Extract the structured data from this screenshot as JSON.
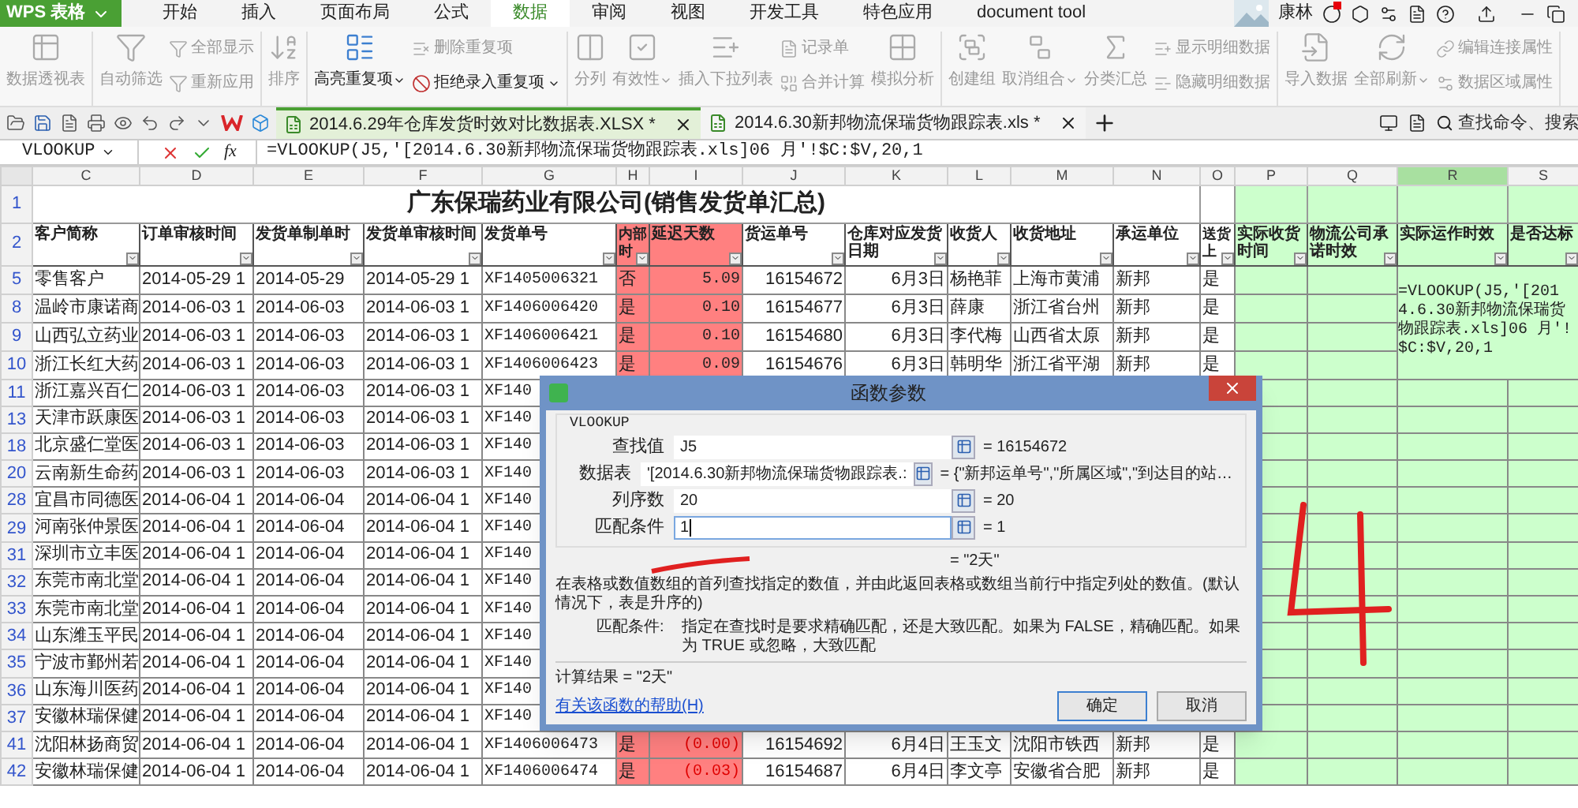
{
  "app_button": {
    "label": "WPS 表格"
  },
  "menu_tabs": [
    {
      "label": "开始",
      "selected": false
    },
    {
      "label": "插入",
      "selected": false
    },
    {
      "label": "页面布局",
      "selected": false
    },
    {
      "label": "公式",
      "selected": false
    },
    {
      "label": "数据",
      "selected": true
    },
    {
      "label": "审阅",
      "selected": false
    },
    {
      "label": "视图",
      "selected": false
    },
    {
      "label": "开发工具",
      "selected": false
    },
    {
      "label": "特色应用",
      "selected": false
    },
    {
      "label": "document tool",
      "selected": false
    }
  ],
  "user": {
    "name": "康林"
  },
  "ribbon": {
    "groups": [
      {
        "columns": [
          {
            "kind": "large",
            "items": [
              {
                "label": "数据透视表",
                "disabled": true,
                "dropdown": false
              }
            ]
          }
        ]
      },
      {
        "columns": [
          {
            "kind": "large",
            "items": [
              {
                "label": "自动筛选",
                "disabled": true,
                "dropdown": false
              }
            ]
          },
          {
            "kind": "small",
            "items": [
              {
                "label": "全部显示",
                "disabled": true,
                "dropdown": false
              },
              {
                "label": "重新应用",
                "disabled": true,
                "dropdown": false
              }
            ]
          }
        ]
      },
      {
        "columns": [
          {
            "kind": "large",
            "items": [
              {
                "label": "排序",
                "disabled": true,
                "dropdown": false
              }
            ]
          }
        ]
      },
      {
        "columns": [
          {
            "kind": "large",
            "items": [
              {
                "label": "高亮重复项",
                "disabled": false,
                "dropdown": true
              }
            ]
          },
          {
            "kind": "small",
            "items": [
              {
                "label": "删除重复项",
                "disabled": true,
                "dropdown": false
              },
              {
                "label": "拒绝录入重复项",
                "disabled": false,
                "dropdown": true
              }
            ]
          }
        ]
      },
      {
        "columns": [
          {
            "kind": "large",
            "items": [
              {
                "label": "分列",
                "disabled": true,
                "dropdown": false
              }
            ]
          },
          {
            "kind": "large",
            "items": [
              {
                "label": "有效性",
                "disabled": true,
                "dropdown": true
              }
            ]
          },
          {
            "kind": "large",
            "items": [
              {
                "label": "插入下拉列表",
                "disabled": true,
                "dropdown": false
              }
            ]
          },
          {
            "kind": "small",
            "items": [
              {
                "label": "记录单",
                "disabled": true,
                "dropdown": false
              },
              {
                "label": "合并计算",
                "disabled": true,
                "dropdown": false
              }
            ]
          },
          {
            "kind": "large",
            "items": [
              {
                "label": "模拟分析",
                "disabled": true,
                "dropdown": false
              }
            ]
          }
        ]
      },
      {
        "columns": [
          {
            "kind": "large",
            "items": [
              {
                "label": "创建组",
                "disabled": true,
                "dropdown": false
              }
            ]
          },
          {
            "kind": "large",
            "items": [
              {
                "label": "取消组合",
                "disabled": true,
                "dropdown": true
              }
            ]
          },
          {
            "kind": "large",
            "items": [
              {
                "label": "分类汇总",
                "disabled": true,
                "dropdown": false
              }
            ]
          },
          {
            "kind": "small",
            "items": [
              {
                "label": "显示明细数据",
                "disabled": true,
                "dropdown": false
              },
              {
                "label": "隐藏明细数据",
                "disabled": true,
                "dropdown": false
              }
            ]
          }
        ]
      },
      {
        "columns": [
          {
            "kind": "large",
            "items": [
              {
                "label": "导入数据",
                "disabled": true,
                "dropdown": false
              }
            ]
          },
          {
            "kind": "large",
            "items": [
              {
                "label": "全部刷新",
                "disabled": true,
                "dropdown": true
              }
            ]
          },
          {
            "kind": "small",
            "items": [
              {
                "label": "编辑连接属性",
                "disabled": true,
                "dropdown": false
              },
              {
                "label": "数据区域属性",
                "disabled": true,
                "dropdown": false
              }
            ]
          }
        ]
      }
    ]
  },
  "file_tabs": [
    {
      "label": "2014.6.29年仓库发货时效对比数据表.XLSX *",
      "selected": true
    },
    {
      "label": "2014.6.30新邦物流保瑞货物跟踪表.xls *",
      "selected": false
    }
  ],
  "command_search": {
    "placeholder": "查找命令、搜索"
  },
  "formula_bar": {
    "name_box": "VLOOKUP",
    "fx_label": "fx",
    "formula": "=VLOOKUP(J5,'[2014.6.30新邦物流保瑞货物跟踪表.xls]06 月'!$C:$V,20,1"
  },
  "sheet": {
    "title_row_num": "1",
    "header_row_num": "2",
    "title": "广东保瑞药业有限公司(销售发货单汇总)",
    "columns": [
      {
        "letter": "C",
        "header": "客户简称",
        "selected": false
      },
      {
        "letter": "D",
        "header": "订单审核时间",
        "selected": false
      },
      {
        "letter": "E",
        "header": "发货单制单时",
        "selected": false
      },
      {
        "letter": "F",
        "header": "发货单审核时间",
        "selected": false
      },
      {
        "letter": "G",
        "header": "发货单号",
        "selected": false
      },
      {
        "letter": "H",
        "header": "内部时",
        "color": "#ff8080",
        "selected": false
      },
      {
        "letter": "I",
        "header": "延迟天数",
        "color": "#ff8080",
        "selected": false
      },
      {
        "letter": "J",
        "header": "货运单号",
        "selected": false
      },
      {
        "letter": "K",
        "header": "仓库对应发货日期",
        "selected": false
      },
      {
        "letter": "L",
        "header": "收货人",
        "selected": false
      },
      {
        "letter": "M",
        "header": "收货地址",
        "selected": false
      },
      {
        "letter": "N",
        "header": "承运单位",
        "selected": false
      },
      {
        "letter": "O",
        "header": "送货上",
        "selected": false
      },
      {
        "letter": "P",
        "header": "实际收货时间",
        "color": "#ccffcc",
        "selected": false
      },
      {
        "letter": "Q",
        "header": "物流公司承诺时效",
        "color": "#ccffcc",
        "selected": false
      },
      {
        "letter": "R",
        "header": "实际运作时效",
        "color": "#ccffcc",
        "selected": true
      },
      {
        "letter": "S",
        "header": "是否达标",
        "color": "#ccffcc",
        "selected": false
      }
    ],
    "rows": [
      {
        "num": "5",
        "negative": false,
        "cells": [
          "零售客户",
          "2014-05-29 1",
          "2014-05-29",
          "2014-05-29 1",
          "XF1405006321",
          "否",
          "5.09",
          "16154672",
          "6月3日",
          "杨艳菲",
          "上海市黄浦",
          "新邦",
          "是"
        ],
        "formula_cell": "=VLOOKUP(J5,'[2014.6.30新邦物流保瑞货物跟踪表.xls]06 月'!$C:$V,20,1"
      },
      {
        "num": "8",
        "negative": false,
        "cells": [
          "温岭市康诺商",
          "2014-06-03 1",
          "2014-06-03",
          "2014-06-03 1",
          "XF1406006420",
          "是",
          "0.10",
          "16154677",
          "6月3日",
          "薛康",
          "浙江省台州",
          "新邦",
          "是"
        ]
      },
      {
        "num": "9",
        "negative": false,
        "cells": [
          "山西弘立药业",
          "2014-06-03 1",
          "2014-06-03",
          "2014-06-03 1",
          "XF1406006421",
          "是",
          "0.10",
          "16154680",
          "6月3日",
          "李代梅",
          "山西省太原",
          "新邦",
          "是"
        ]
      },
      {
        "num": "10",
        "negative": false,
        "cells": [
          "浙江长红大药",
          "2014-06-03 1",
          "2014-06-03",
          "2014-06-03 1",
          "XF1406006423",
          "是",
          "0.09",
          "16154676",
          "6月3日",
          "韩明华",
          "浙江省平湖",
          "新邦",
          "是"
        ]
      },
      {
        "num": "11",
        "cells": [
          "浙江嘉兴百仁",
          "2014-06-03 1",
          "2014-06-03",
          "2014-06-03 1",
          "XF140"
        ]
      },
      {
        "num": "13",
        "cells": [
          "天津市跃康医",
          "2014-06-03 1",
          "2014-06-03",
          "2014-06-03 1",
          "XF140"
        ]
      },
      {
        "num": "18",
        "cells": [
          "北京盛仁堂医",
          "2014-06-03 1",
          "2014-06-03",
          "2014-06-03 1",
          "XF140"
        ]
      },
      {
        "num": "20",
        "cells": [
          "云南新生命药",
          "2014-06-03 1",
          "2014-06-03",
          "2014-06-03 1",
          "XF140"
        ]
      },
      {
        "num": "28",
        "cells": [
          "宜昌市同德医",
          "2014-06-04 1",
          "2014-06-04",
          "2014-06-04 1",
          "XF140"
        ]
      },
      {
        "num": "29",
        "cells": [
          "河南张仲景医",
          "2014-06-04 1",
          "2014-06-04",
          "2014-06-04 1",
          "XF140"
        ]
      },
      {
        "num": "31",
        "cells": [
          "深圳市立丰医",
          "2014-06-04 1",
          "2014-06-04",
          "2014-06-04 1",
          "XF140"
        ]
      },
      {
        "num": "32",
        "cells": [
          "东莞市南北堂",
          "2014-06-04 1",
          "2014-06-04",
          "2014-06-04 1",
          "XF140"
        ]
      },
      {
        "num": "33",
        "cells": [
          "东莞市南北堂",
          "2014-06-04 1",
          "2014-06-04",
          "2014-06-04 1",
          "XF140"
        ]
      },
      {
        "num": "34",
        "cells": [
          "山东潍玉平民",
          "2014-06-04 1",
          "2014-06-04",
          "2014-06-04 1",
          "XF140"
        ]
      },
      {
        "num": "35",
        "cells": [
          "宁波市鄞州若",
          "2014-06-04 1",
          "2014-06-04",
          "2014-06-04 1",
          "XF140"
        ]
      },
      {
        "num": "36",
        "cells": [
          "山东海川医药",
          "2014-06-04 1",
          "2014-06-04",
          "2014-06-04 1",
          "XF140"
        ]
      },
      {
        "num": "37",
        "cells": [
          "安徽林瑞保健",
          "2014-06-04 1",
          "2014-06-04",
          "2014-06-04 1",
          "XF140"
        ]
      },
      {
        "num": "41",
        "negative": true,
        "cells": [
          "沈阳林扬商贸",
          "2014-06-04 1",
          "2014-06-04",
          "2014-06-04 1",
          "XF1406006473",
          "是",
          "(0.00)",
          "16154692",
          "6月4日",
          "王玉文",
          "沈阳市铁西",
          "新邦",
          "是"
        ]
      },
      {
        "num": "42",
        "negative": true,
        "cells": [
          "安徽林瑞保健",
          "2014-06-04 1",
          "2014-06-04",
          "2014-06-04 1",
          "XF1406006474",
          "是",
          "(0.03)",
          "16154687",
          "6月4日",
          "李文亭",
          "安徽省合肥",
          "新邦",
          "是"
        ]
      }
    ]
  },
  "dialog": {
    "title": "函数参数",
    "group_label": "VLOOKUP",
    "args": [
      {
        "label": "查找值",
        "value": "J5",
        "result": "= 16154672",
        "focused": false
      },
      {
        "label": "数据表",
        "value": "'[2014.6.30新邦物流保瑞货物跟踪表.:",
        "result": "= {\"新邦运单号\",\"所属区域\",\"到达目的站…",
        "focused": false
      },
      {
        "label": "列序数",
        "value": "20",
        "result": "= 20",
        "focused": false
      },
      {
        "label": "匹配条件",
        "value": "1",
        "result": "= 1",
        "focused": true
      }
    ],
    "result_line": "= \"2天\"",
    "description": "在表格或数值数组的首列查找指定的数值，并由此返回表格或数组当前行中指定列处的数值。(默认情况下，表是升序的)",
    "param_name": "匹配条件:",
    "param_desc": "指定在查找时是要求精确匹配，还是大致匹配。如果为 FALSE，精确匹配。如果为 TRUE 或忽略，大致匹配",
    "calc_result": "计算结果 = \"2天\"",
    "help_link": "有关该函数的帮助(H)",
    "buttons": [
      {
        "label": "确定",
        "default": true
      },
      {
        "label": "取消",
        "default": false
      }
    ]
  }
}
